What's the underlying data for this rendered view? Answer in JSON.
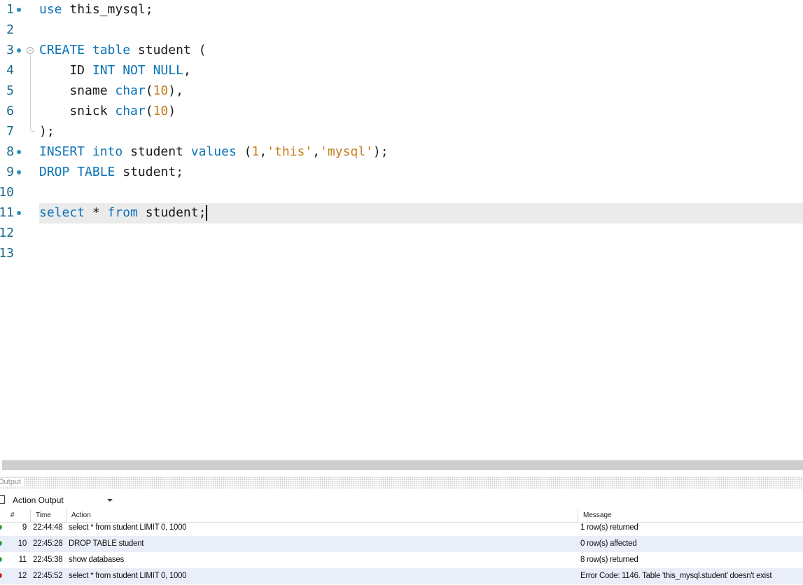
{
  "editor": {
    "lines": [
      {
        "num": "1",
        "tokens": [
          {
            "t": "use",
            "c": "kw"
          },
          {
            "t": " this_mysql;",
            "c": ""
          }
        ],
        "bullet": true
      },
      {
        "num": "2",
        "tokens": [],
        "bullet": false
      },
      {
        "num": "3",
        "tokens": [
          {
            "t": "CREATE",
            "c": "kw"
          },
          {
            "t": " ",
            "c": ""
          },
          {
            "t": "table",
            "c": "kw"
          },
          {
            "t": " student (",
            "c": ""
          }
        ],
        "bullet": true,
        "fold": true
      },
      {
        "num": "4",
        "tokens": [
          {
            "t": "    ID ",
            "c": ""
          },
          {
            "t": "INT",
            "c": "kw"
          },
          {
            "t": " ",
            "c": ""
          },
          {
            "t": "NOT",
            "c": "kw"
          },
          {
            "t": " ",
            "c": ""
          },
          {
            "t": "NULL",
            "c": "kw"
          },
          {
            "t": ",",
            "c": ""
          }
        ],
        "bullet": false
      },
      {
        "num": "5",
        "tokens": [
          {
            "t": "    sname ",
            "c": ""
          },
          {
            "t": "char",
            "c": "kw"
          },
          {
            "t": "(",
            "c": ""
          },
          {
            "t": "10",
            "c": "num"
          },
          {
            "t": "),",
            "c": ""
          }
        ],
        "bullet": false
      },
      {
        "num": "6",
        "tokens": [
          {
            "t": "    snick ",
            "c": ""
          },
          {
            "t": "char",
            "c": "kw"
          },
          {
            "t": "(",
            "c": ""
          },
          {
            "t": "10",
            "c": "num"
          },
          {
            "t": ")",
            "c": ""
          }
        ],
        "bullet": false
      },
      {
        "num": "7",
        "tokens": [
          {
            "t": ");",
            "c": ""
          }
        ],
        "bullet": false
      },
      {
        "num": "8",
        "tokens": [
          {
            "t": "INSERT",
            "c": "kw"
          },
          {
            "t": " ",
            "c": ""
          },
          {
            "t": "into",
            "c": "kw"
          },
          {
            "t": " student ",
            "c": ""
          },
          {
            "t": "values",
            "c": "kw"
          },
          {
            "t": " (",
            "c": ""
          },
          {
            "t": "1",
            "c": "num"
          },
          {
            "t": ",",
            "c": ""
          },
          {
            "t": "'this'",
            "c": "str"
          },
          {
            "t": ",",
            "c": ""
          },
          {
            "t": "'mysql'",
            "c": "str"
          },
          {
            "t": ");",
            "c": ""
          }
        ],
        "bullet": true
      },
      {
        "num": "9",
        "tokens": [
          {
            "t": "DROP",
            "c": "kw"
          },
          {
            "t": " ",
            "c": ""
          },
          {
            "t": "TABLE",
            "c": "kw"
          },
          {
            "t": " student;",
            "c": ""
          }
        ],
        "bullet": true
      },
      {
        "num": "10",
        "tokens": [],
        "bullet": false
      },
      {
        "num": "11",
        "tokens": [
          {
            "t": "select",
            "c": "kw"
          },
          {
            "t": " * ",
            "c": ""
          },
          {
            "t": "from",
            "c": "kw"
          },
          {
            "t": " student;",
            "c": ""
          }
        ],
        "bullet": true,
        "current": true,
        "caret": true
      },
      {
        "num": "12",
        "tokens": [],
        "bullet": false
      },
      {
        "num": "13",
        "tokens": [],
        "bullet": false
      }
    ]
  },
  "output": {
    "title": "Output",
    "selector_value": "Action Output",
    "columns": {
      "num": "#",
      "time": "Time",
      "action": "Action",
      "message": "Message"
    },
    "rows": [
      {
        "status": "ok",
        "num": "9",
        "time": "22:44:48",
        "action": "select * from student LIMIT 0, 1000",
        "message": "1 row(s) returned"
      },
      {
        "status": "ok",
        "num": "10",
        "time": "22:45:28",
        "action": "DROP TABLE student",
        "message": "0 row(s) affected"
      },
      {
        "status": "ok",
        "num": "11",
        "time": "22:45:38",
        "action": "show databases",
        "message": "8 row(s) returned"
      },
      {
        "status": "err",
        "num": "12",
        "time": "22:45:52",
        "action": "select * from student LIMIT 0, 1000",
        "message": "Error Code: 1146. Table 'this_mysql.student' doesn't exist"
      }
    ]
  }
}
